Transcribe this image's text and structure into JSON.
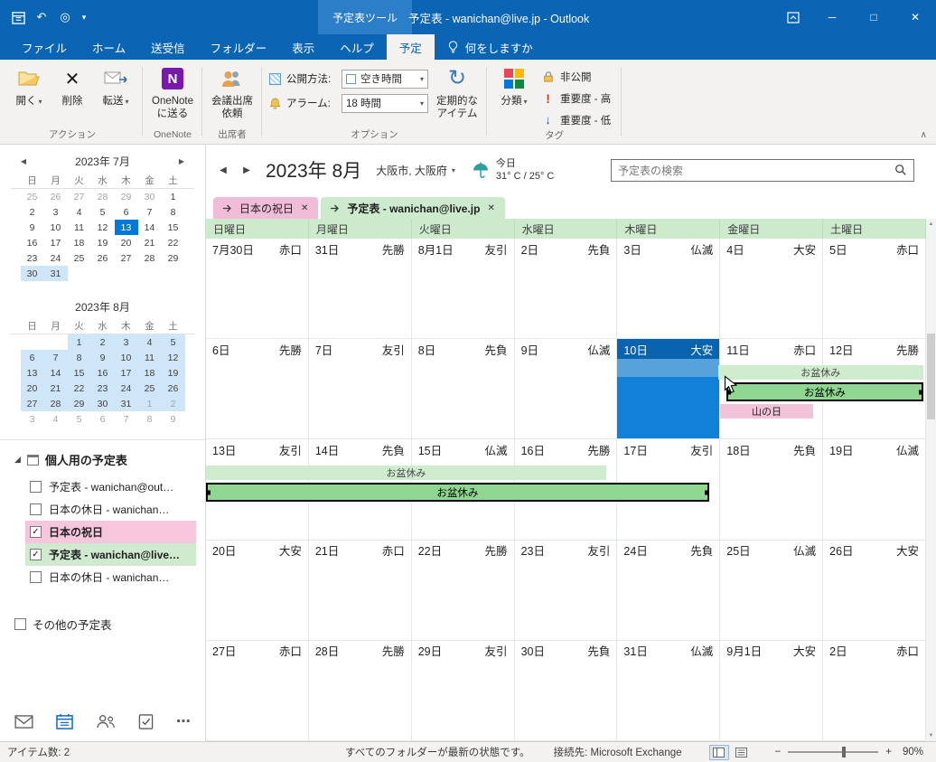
{
  "window": {
    "contextual_tab": "予定表ツール",
    "title": "予定表 - wanichan@live.jp - Outlook"
  },
  "ribbon_tabs": {
    "file": "ファイル",
    "tabs": [
      "ホーム",
      "送受信",
      "フォルダー",
      "表示",
      "ヘルプ"
    ],
    "active_tab": "予定",
    "tell_me": "何をしますか"
  },
  "ribbon": {
    "actions": {
      "group": "アクション",
      "open": "開く",
      "delete": "削除",
      "forward": "転送"
    },
    "onenote": {
      "group": "OneNote",
      "send_to": "OneNote\nに送る"
    },
    "attendees": {
      "group": "出席者",
      "meeting_invite": "会議出席\n依頼"
    },
    "options": {
      "group": "オプション",
      "show_as_label": "公開方法:",
      "show_as_value": "空き時間",
      "reminder_label": "アラーム:",
      "reminder_value": "18 時間",
      "recurrence": "定期的な\nアイテム"
    },
    "tags": {
      "group": "タグ",
      "categorize": "分類",
      "private": "非公開",
      "importance_high": "重要度 - 高",
      "importance_low": "重要度 - 低"
    }
  },
  "sidebar": {
    "mini_calendars": [
      {
        "title": "2023年 7月",
        "day_headers": [
          "日",
          "月",
          "火",
          "水",
          "木",
          "金",
          "土"
        ],
        "weeks": [
          [
            "25m",
            "26m",
            "27m",
            "28m",
            "29m",
            "30m",
            "1"
          ],
          [
            "2",
            "3",
            "4",
            "5",
            "6",
            "7",
            "8"
          ],
          [
            "9",
            "10",
            "11",
            "12",
            "13t",
            "14",
            "15"
          ],
          [
            "16",
            "17",
            "18",
            "19",
            "20",
            "21",
            "22"
          ],
          [
            "23",
            "24",
            "25",
            "26",
            "27",
            "28",
            "29"
          ],
          [
            "30h",
            "31h",
            "",
            "",
            "",
            "",
            ""
          ]
        ]
      },
      {
        "title": "2023年 8月",
        "day_headers": [
          "日",
          "月",
          "火",
          "水",
          "木",
          "金",
          "土"
        ],
        "weeks": [
          [
            "",
            "",
            "1h",
            "2h",
            "3h",
            "4h",
            "5h"
          ],
          [
            "6h",
            "7h",
            "8h",
            "9h",
            "10h",
            "11h",
            "12h"
          ],
          [
            "13h",
            "14h",
            "15h",
            "16h",
            "17h",
            "18h",
            "19h"
          ],
          [
            "20h",
            "21h",
            "22h",
            "23h",
            "24h",
            "25h",
            "26h"
          ],
          [
            "27h",
            "28h",
            "29h",
            "30h",
            "31h",
            "1mh",
            "2mh"
          ],
          [
            "3m",
            "4m",
            "5m",
            "6m",
            "7m",
            "8m",
            "9m"
          ]
        ]
      }
    ],
    "groups": [
      {
        "label": "個人用の予定表",
        "items": [
          {
            "label": "予定表 - wanichan@out…",
            "checked": false,
            "style": ""
          },
          {
            "label": "日本の休日 - wanichan…",
            "checked": false,
            "style": ""
          },
          {
            "label": "日本の祝日",
            "checked": true,
            "style": "pink"
          },
          {
            "label": "予定表 - wanichan@live…",
            "checked": true,
            "style": "green"
          },
          {
            "label": "日本の休日 - wanichan…",
            "checked": false,
            "style": ""
          }
        ]
      },
      {
        "label": "その他の予定表",
        "items": []
      }
    ]
  },
  "calendar": {
    "month_title": "2023年 8月",
    "location": "大阪市, 大阪府",
    "weather": {
      "today_label": "今日",
      "temps": "31° C / 25° C"
    },
    "search_placeholder": "予定表の検索",
    "tabs": [
      {
        "label": "日本の祝日",
        "theme": "pink",
        "active": false
      },
      {
        "label": "予定表 - wanichan@live.jp",
        "theme": "green",
        "active": true
      }
    ],
    "day_headers": [
      "日曜日",
      "月曜日",
      "火曜日",
      "水曜日",
      "木曜日",
      "金曜日",
      "土曜日"
    ],
    "weeks": [
      {
        "days": [
          [
            "7月30日",
            "赤口"
          ],
          [
            "31日",
            "先勝"
          ],
          [
            "8月1日",
            "友引"
          ],
          [
            "2日",
            "先負"
          ],
          [
            "3日",
            "仏滅"
          ],
          [
            "4日",
            "大安"
          ],
          [
            "5日",
            "赤口"
          ]
        ],
        "events": []
      },
      {
        "days": [
          [
            "6日",
            "先勝"
          ],
          [
            "7日",
            "友引"
          ],
          [
            "8日",
            "先負"
          ],
          [
            "9日",
            "仏滅"
          ],
          [
            "10日",
            "大安"
          ],
          [
            "11日",
            "赤口"
          ],
          [
            "12日",
            "先勝"
          ]
        ],
        "selected": 4,
        "events": [
          {
            "name": "obon-holiday-overlay",
            "label": "お盆休み",
            "type": "light",
            "start": 4.98,
            "end": 6.97,
            "lane": 0
          },
          {
            "name": "obon-holiday-selected",
            "label": "お盆休み",
            "type": "active",
            "start": 5.06,
            "end": 6.97,
            "lane": 1
          },
          {
            "name": "mountain-day-holiday",
            "label": "山の日",
            "type": "pink",
            "start": 5.0,
            "end": 5.9,
            "lane": 2
          }
        ]
      },
      {
        "days": [
          [
            "13日",
            "友引"
          ],
          [
            "14日",
            "先負"
          ],
          [
            "15日",
            "仏滅"
          ],
          [
            "16日",
            "先勝"
          ],
          [
            "17日",
            "友引"
          ],
          [
            "18日",
            "先負"
          ],
          [
            "19日",
            "仏滅"
          ]
        ],
        "events": [
          {
            "name": "obon-holiday-overlay",
            "label": "お盆休み",
            "type": "light",
            "start": 0,
            "end": 3.89,
            "lane": 0
          },
          {
            "name": "obon-holiday-selected",
            "label": "お盆休み",
            "type": "active",
            "start": 0,
            "end": 4.89,
            "lane": 1
          }
        ]
      },
      {
        "days": [
          [
            "20日",
            "大安"
          ],
          [
            "21日",
            "赤口"
          ],
          [
            "22日",
            "先勝"
          ],
          [
            "23日",
            "友引"
          ],
          [
            "24日",
            "先負"
          ],
          [
            "25日",
            "仏滅"
          ],
          [
            "26日",
            "大安"
          ]
        ],
        "events": []
      },
      {
        "days": [
          [
            "27日",
            "赤口"
          ],
          [
            "28日",
            "先勝"
          ],
          [
            "29日",
            "友引"
          ],
          [
            "30日",
            "先負"
          ],
          [
            "31日",
            "仏滅"
          ],
          [
            "9月1日",
            "大安"
          ],
          [
            "2日",
            "赤口"
          ]
        ],
        "events": []
      }
    ]
  },
  "statusbar": {
    "items_count": "アイテム数: 2",
    "folder_status": "すべてのフォルダーが最新の状態です。",
    "connection": "接続先: Microsoft Exchange",
    "zoom": "90%"
  },
  "icons": {
    "dropdown": "▾",
    "delete_x": "✕",
    "undo": "↶",
    "touch_mode": "◎",
    "qat_menu": "▾",
    "minimize": "─",
    "maximize": "□",
    "close": "✕",
    "prev_arrow": "◀",
    "next_arrow": "▶",
    "location_caret": "▾",
    "recurrence": "↻",
    "importance_high": "!",
    "importance_low": "↓",
    "check": "✓",
    "expanded_triangle": "◢",
    "onenote_letter": "N",
    "more_dots": "⋯",
    "collapse_ribbon": "∧",
    "scroll_up": "▲",
    "scroll_down": "▼",
    "tab_close": "✕",
    "zoom_out": "−",
    "zoom_in": "+"
  },
  "colors": {
    "accent_blue": "#0b64b4",
    "selected_day_blue": "#1180d8",
    "today_blue": "#0078d7",
    "holiday_pink": "#f2c3d8",
    "calendar_green": "#cdeacd",
    "active_event_green": "#8fd791"
  },
  "category_colors": [
    "#e74856",
    "#ffb900",
    "#0078d7",
    "#10893e"
  ]
}
